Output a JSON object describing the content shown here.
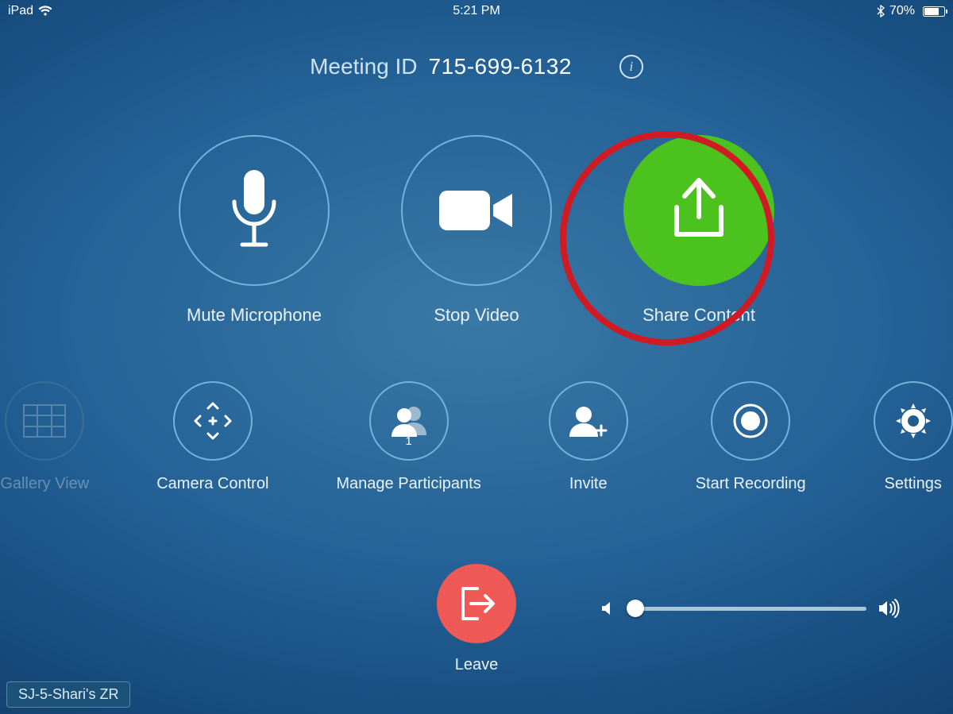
{
  "status": {
    "device": "iPad",
    "time": "5:21 PM",
    "battery_percent": "70%"
  },
  "header": {
    "label": "Meeting ID",
    "value": "715-699-6132"
  },
  "primary": {
    "mute": "Mute Microphone",
    "video": "Stop Video",
    "share": "Share Content"
  },
  "secondary": {
    "gallery": "Gallery View",
    "camera": "Camera Control",
    "participants": "Manage Participants",
    "participants_count": "1",
    "invite": "Invite",
    "record": "Start Recording",
    "settings": "Settings"
  },
  "leave_label": "Leave",
  "room_name": "SJ-5-Shari's ZR"
}
